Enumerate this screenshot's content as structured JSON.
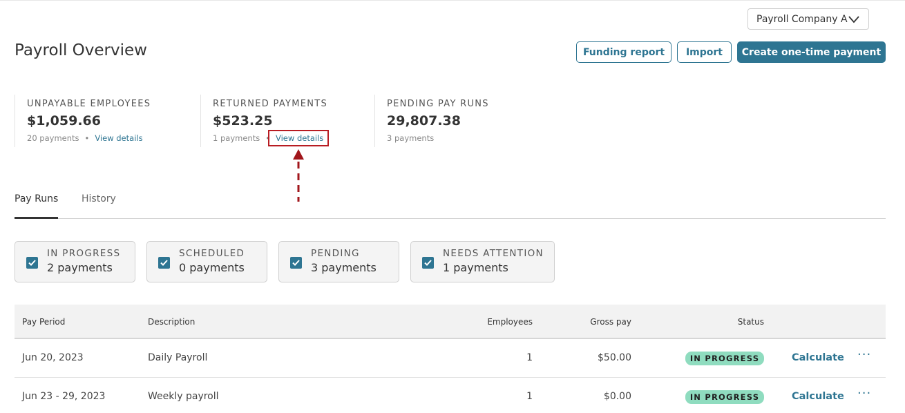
{
  "header": {
    "company_select": "Payroll Company A",
    "title": "Payroll Overview",
    "funding_report": "Funding report",
    "import": "Import",
    "create_payment": "Create one-time payment"
  },
  "stats": [
    {
      "label": "UNPAYABLE EMPLOYEES",
      "value": "$1,059.66",
      "sub": "20 payments",
      "link": "View details"
    },
    {
      "label": "RETURNED PAYMENTS",
      "value": "$523.25",
      "sub": "1 payments",
      "link": "View details"
    },
    {
      "label": "PENDING PAY RUNS",
      "value": "29,807.38",
      "sub": "3 payments"
    }
  ],
  "tabs": [
    {
      "label": "Pay Runs"
    },
    {
      "label": "History"
    }
  ],
  "filters": [
    {
      "label": "IN PROGRESS",
      "count": "2 payments"
    },
    {
      "label": "SCHEDULED",
      "count": "0 payments"
    },
    {
      "label": "PENDING",
      "count": "3 payments"
    },
    {
      "label": "NEEDS ATTENTION",
      "count": "1 payments"
    }
  ],
  "table": {
    "headers": {
      "pay_period": "Pay Period",
      "description": "Description",
      "employees": "Employees",
      "gross_pay": "Gross pay",
      "status": "Status"
    },
    "rows": [
      {
        "pay_period": "Jun 20, 2023",
        "description": "Daily Payroll",
        "employees": "1",
        "gross_pay": "$50.00",
        "status": "IN PROGRESS",
        "action": "Calculate",
        "more": "···"
      },
      {
        "pay_period": "Jun 23 - 29, 2023",
        "description": "Weekly payroll",
        "employees": "1",
        "gross_pay": "$0.00",
        "status": "IN PROGRESS",
        "action": "Calculate",
        "more": "···"
      }
    ]
  },
  "colors": {
    "accent": "#2e7592",
    "status_badge": "#8fdcbf",
    "annotation": "#b81c22"
  }
}
